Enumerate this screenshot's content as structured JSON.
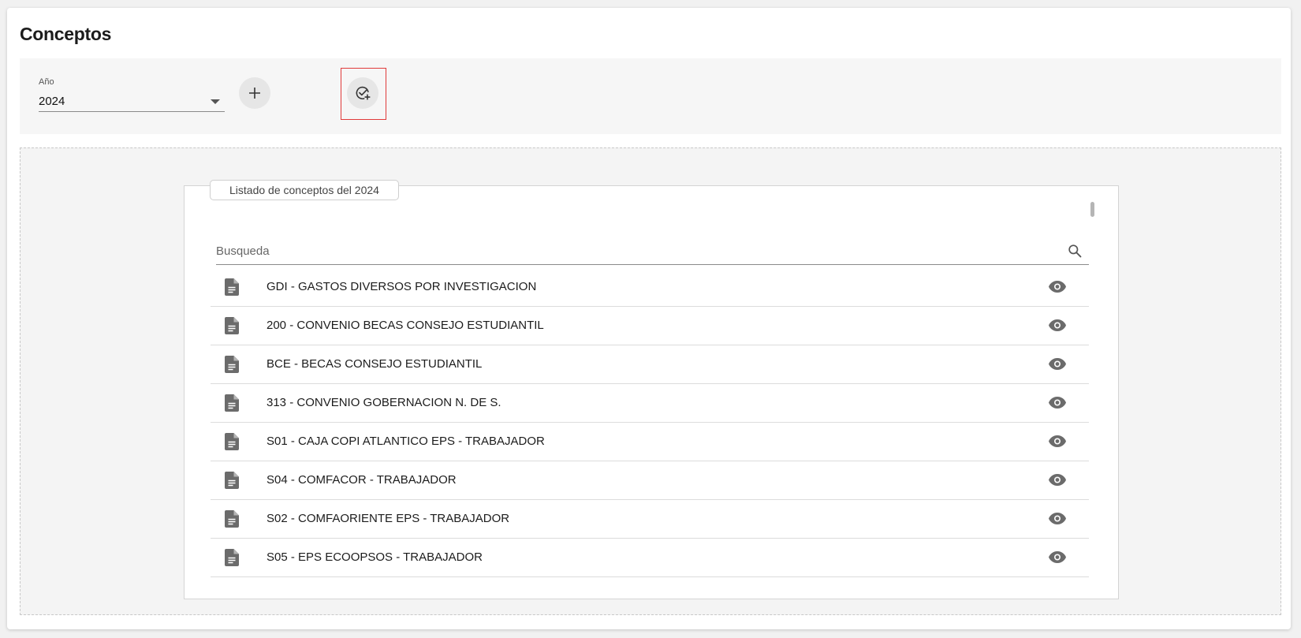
{
  "header": {
    "title": "Conceptos"
  },
  "toolbar": {
    "year_label": "Año",
    "year_value": "2024",
    "icons": {
      "add": "plus-icon",
      "assign": "check-circle-plus-icon",
      "dropdown": "caret-down-icon"
    }
  },
  "panel": {
    "title": "Listado de conceptos del 2024",
    "search_placeholder": "Busqueda",
    "search_value": "",
    "items": [
      {
        "label": "GDI - GASTOS DIVERSOS POR INVESTIGACION"
      },
      {
        "label": "200 - CONVENIO BECAS CONSEJO ESTUDIANTIL"
      },
      {
        "label": "BCE - BECAS CONSEJO ESTUDIANTIL"
      },
      {
        "label": "313 - CONVENIO GOBERNACION N. DE S."
      },
      {
        "label": "S01 - CAJA COPI ATLANTICO EPS - TRABAJADOR"
      },
      {
        "label": "S04 - COMFACOR - TRABAJADOR"
      },
      {
        "label": "S02 - COMFAORIENTE EPS - TRABAJADOR"
      },
      {
        "label": "S05 - EPS ECOOPSOS - TRABAJADOR"
      }
    ],
    "item_icons": {
      "leading": "document-icon",
      "trailing": "eye-icon"
    }
  },
  "colors": {
    "highlight": "#e03a3a",
    "icon": "#6b6b6b"
  }
}
